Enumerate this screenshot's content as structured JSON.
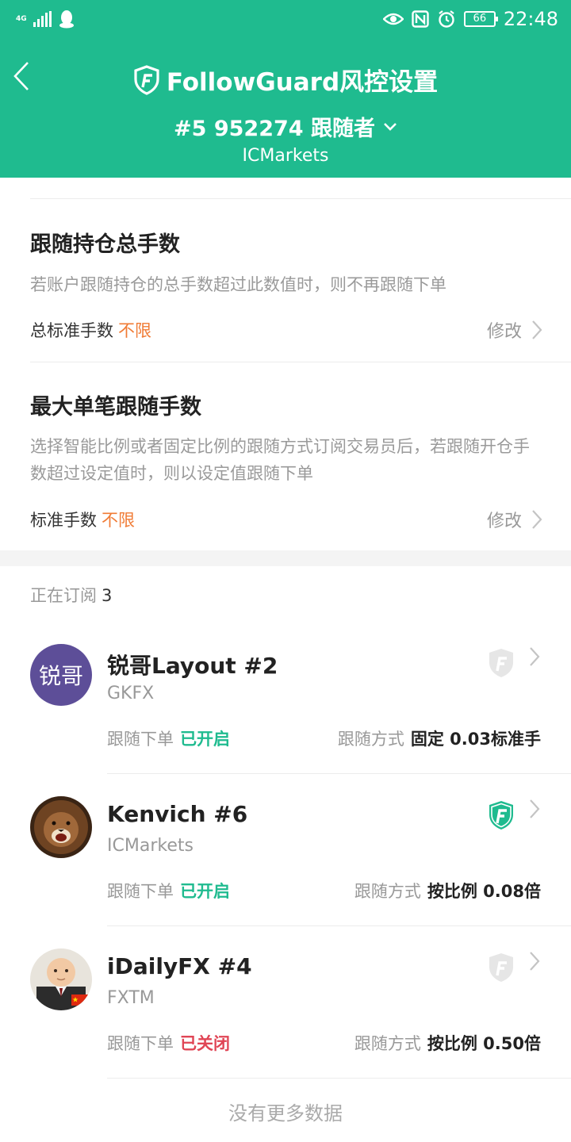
{
  "status_bar": {
    "network": "4G",
    "battery": "66",
    "time": "22:48"
  },
  "header": {
    "title": "FollowGuard风控设置",
    "account": "#5 952274 跟随者",
    "broker": "ICMarkets"
  },
  "settings": [
    {
      "title": "跟随持仓总手数",
      "desc": "若账户跟随持仓的总手数超过此数值时，则不再跟随下单",
      "label": "总标准手数",
      "value": "不限",
      "edit": "修改"
    },
    {
      "title": "最大单笔跟随手数",
      "desc": "选择智能比例或者固定比例的跟随方式订阅交易员后，若跟随开仓手数超过设定值时，则以设定值跟随下单",
      "label": "标准手数",
      "value": "不限",
      "edit": "修改"
    }
  ],
  "subscriptions": {
    "label": "正在订阅",
    "count": "3",
    "items": [
      {
        "avatar_text": "锐哥",
        "name": "锐哥Layout #2",
        "broker": "GKFX",
        "status_label": "跟随下单",
        "status": "已开启",
        "mode_label": "跟随方式",
        "mode": "固定 0.03标准手",
        "guard": "off"
      },
      {
        "avatar_text": "",
        "name": "Kenvich #6",
        "broker": "ICMarkets",
        "status_label": "跟随下单",
        "status": "已开启",
        "mode_label": "跟随方式",
        "mode": "按比例 0.08倍",
        "guard": "on"
      },
      {
        "avatar_text": "",
        "name": "iDailyFX #4",
        "broker": "FXTM",
        "status_label": "跟随下单",
        "status": "已关闭",
        "mode_label": "跟随方式",
        "mode": "按比例 0.50倍",
        "guard": "off"
      }
    ]
  },
  "footer": {
    "no_more": "没有更多数据"
  },
  "colors": {
    "header_bg": "#1fbb8f",
    "accent_orange": "#f07b35",
    "status_on": "#1fbb8f",
    "status_off": "#e04555"
  }
}
